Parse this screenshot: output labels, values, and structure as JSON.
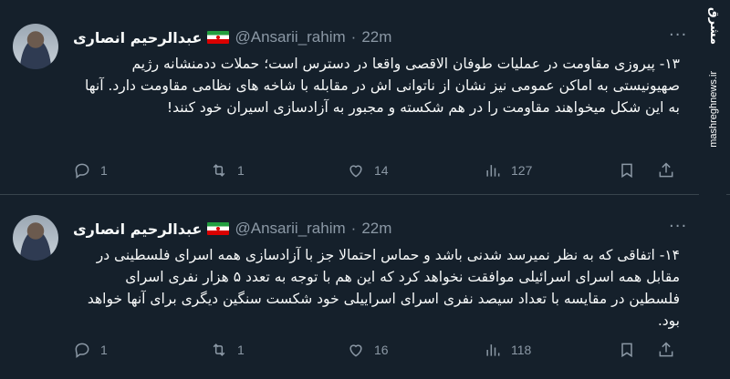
{
  "tweets": [
    {
      "display_name": "عبدالرحیم انصاری",
      "handle": "@Ansarii_rahim",
      "dot": "·",
      "time": "22m",
      "text": "۱۳- پیروزی مقاومت در عملیات طوفان الاقصی واقعا در دسترس است؛ حملات ددمنشانه رژیم صهیونیستی به اماکن عمومی نیز نشان از ناتوانی اش در مقابله با شاخه های نظامی مقاومت دارد. آنها به این شکل میخواهند مقاومت را در هم شکسته و مجبور به آزادسازی اسیران خود کنند!",
      "replies": "1",
      "retweets": "1",
      "likes": "14",
      "views": "127"
    },
    {
      "display_name": "عبدالرحیم انصاری",
      "handle": "@Ansarii_rahim",
      "dot": "·",
      "time": "22m",
      "text": "۱۴- اتفاقی که به نظر نمیرسد شدنی باشد و حماس احتمالا جز با آزادسازی همه اسرای فلسطینی در مقابل همه اسرای اسرائیلی موافقت نخواهد کرد که این هم با توجه به تعدد ۵ هزار نفری اسرای فلسطین در مقایسه با تعداد سیصد نفری اسرای اسراییلی خود شکست سنگین دیگری برای آنها خواهد بود.",
      "replies": "1",
      "retweets": "1",
      "likes": "16",
      "views": "118"
    }
  ],
  "more_glyph": "···",
  "watermark": {
    "logo": "مشرق",
    "url": "mashreghnews.ir"
  },
  "icons": [
    "reply-icon",
    "retweet-icon",
    "like-icon",
    "views-icon",
    "bookmark-icon",
    "share-icon"
  ]
}
